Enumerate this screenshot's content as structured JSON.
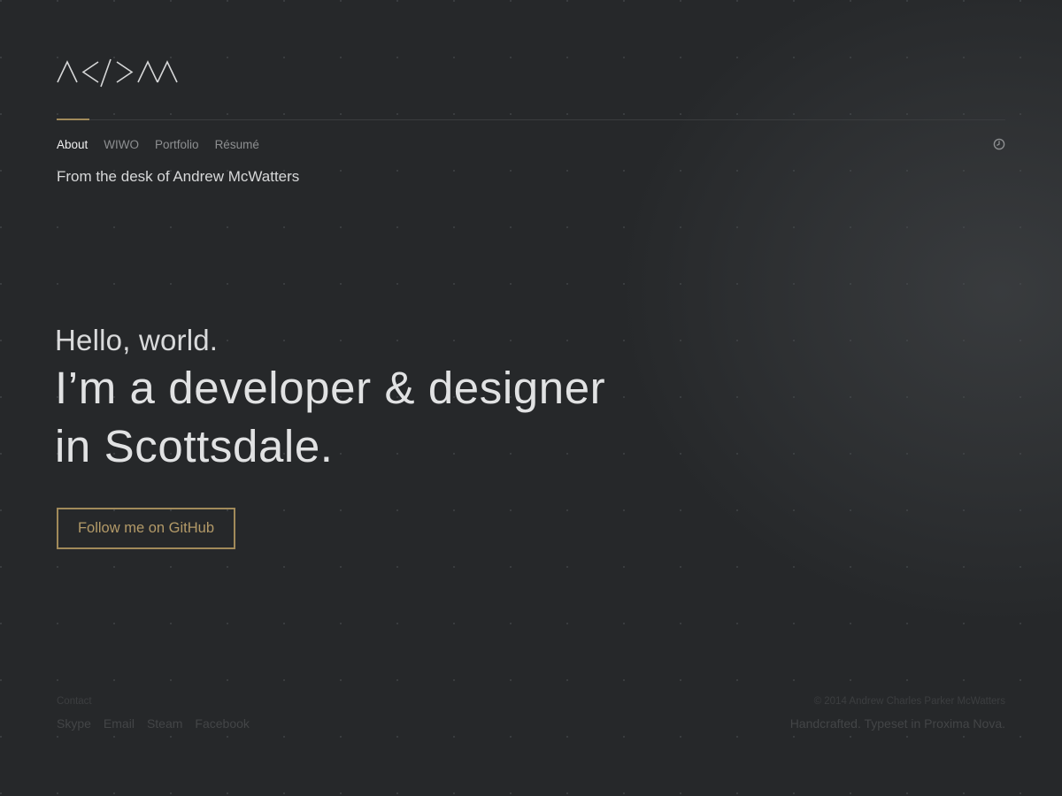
{
  "brand": {
    "logo_icon": "acpm-monogram-logo",
    "logo_text": "/\\</>/\\/\\"
  },
  "nav": {
    "items": [
      {
        "label": "About",
        "active": true
      },
      {
        "label": "WIWO",
        "active": false
      },
      {
        "label": "Portfolio",
        "active": false
      },
      {
        "label": "Résumé",
        "active": false
      }
    ],
    "clock_icon": "clock-icon"
  },
  "tagline": "From the desk of Andrew McWatters",
  "hero": {
    "hello": "Hello, world.",
    "line1": "I’m a developer & designer",
    "line2": "in Scottsdale."
  },
  "cta": {
    "github_label": "Follow me on GitHub"
  },
  "footer": {
    "contact_label": "Contact",
    "links": [
      "Skype",
      "Email",
      "Steam",
      "Facebook"
    ],
    "copyright": "© 2014 Andrew Charles Parker McWatters",
    "credit": "Handcrafted. Typeset in Proxima Nova."
  },
  "colors": {
    "background": "#26282a",
    "accent_gold": "#a18a5a",
    "text_primary": "#e1e2e3",
    "text_muted": "#8d8f91"
  }
}
